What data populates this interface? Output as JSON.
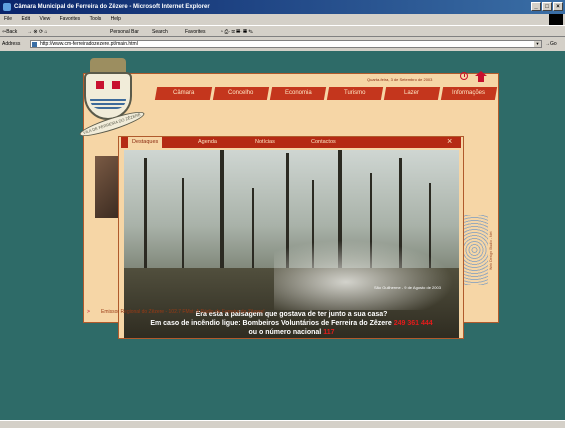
{
  "window": {
    "title": "Câmara Municipal de Ferreira do Zêzere - Microsoft Internet Explorer",
    "buttons": [
      "_",
      "□",
      "×"
    ]
  },
  "menu": [
    "File",
    "Edit",
    "View",
    "Favorites",
    "Tools",
    "Help"
  ],
  "toolbar": {
    "back": "⇦Back",
    "personal_bar": "Personal Bar",
    "search": "Search",
    "favorites": "Favorites"
  },
  "address": {
    "label": "Address",
    "url": "http://www.cm-ferreiradozezere.pt/main.html",
    "go": "Go"
  },
  "site": {
    "date": "Quarta-feira, 3 de Setembro de 2003",
    "crest_motto": "VILA DE FERREIRA DO ZÊZERE",
    "nav": [
      "Câmara",
      "Concelho",
      "Economia",
      "Turismo",
      "Lazer",
      "Informações"
    ],
    "tabs": [
      "Destaques",
      "Agenda",
      "Notícias",
      "Contactos"
    ],
    "close": "×",
    "photo_credit": "São Guilherme - 9 de Agosto de 2003",
    "caption": {
      "line1": "Era esta a paisagem que gostava de ter junto a sua casa?",
      "line2_prefix": "Em caso de incêndio ligue: Bombeiros Voluntários de Ferreira do Zêzere",
      "line2_phone": "249 361 444",
      "line3_prefix": "ou o número nacional",
      "line3_number": "117"
    },
    "ticker": "Emissor Regional do Zêzere - 102.7 FMst: A Rádio de Ferreira do Zêzere!",
    "vertical_credit": "Web Design Studio - Net"
  },
  "colors": {
    "page_bg": "#2e6b68",
    "accent": "#c4361d",
    "panel": "#f6d6a6"
  }
}
